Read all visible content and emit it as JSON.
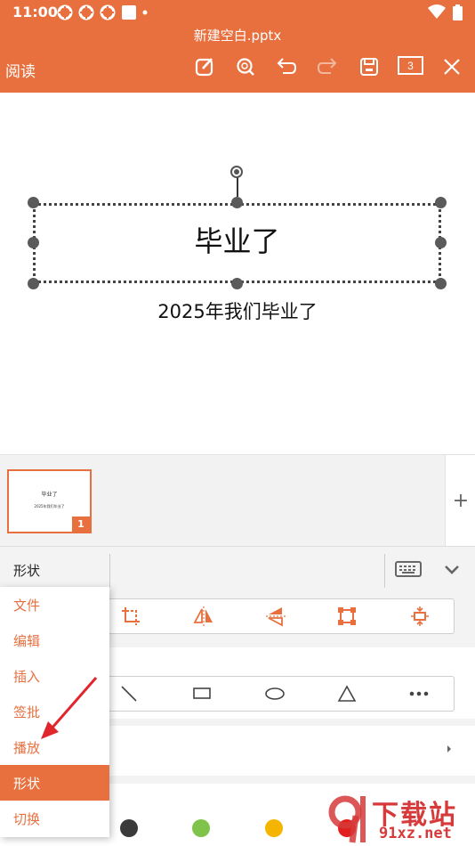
{
  "status_bar": {
    "time": "11:00",
    "icons": [
      "notification-icon",
      "notification-icon",
      "notification-icon",
      "square-icon",
      "dot-icon"
    ],
    "right_icons": [
      "wifi-icon",
      "battery-icon"
    ]
  },
  "header": {
    "file_name": "新建空白.pptx",
    "mode_label": "阅读",
    "page_count": "3",
    "toolbar_icons": [
      "edit-icon",
      "search-icon",
      "undo-icon",
      "redo-icon",
      "save-icon",
      "page-count",
      "close-icon"
    ]
  },
  "slide": {
    "title": "毕业了",
    "subtitle": "2025年我们毕业了"
  },
  "thumbnails": {
    "items": [
      {
        "number": "1",
        "title": "毕业了",
        "subtitle": "2025年我们毕业了"
      }
    ],
    "add_icon": "+"
  },
  "bottom_panel": {
    "current_tab": "形状",
    "arrange_tools": [
      "crop-icon",
      "flip-horizontal-icon",
      "flip-vertical-icon",
      "resize-icon",
      "align-center-icon"
    ],
    "shape_tools": [
      "line-icon",
      "rectangle-icon",
      "ellipse-icon",
      "triangle-icon",
      "more-icon"
    ],
    "color_swatches": [
      "#3a3a3a",
      "#7fc34a",
      "#f5b400",
      "#e02020"
    ]
  },
  "menu": {
    "items": [
      {
        "label": "文件",
        "active": false
      },
      {
        "label": "编辑",
        "active": false
      },
      {
        "label": "插入",
        "active": false
      },
      {
        "label": "签批",
        "active": false
      },
      {
        "label": "播放",
        "active": false
      },
      {
        "label": "形状",
        "active": true
      },
      {
        "label": "切换",
        "active": false
      }
    ]
  },
  "watermark": {
    "cn": "下载站",
    "en": "91xz.net"
  },
  "colors": {
    "accent": "#E8703F",
    "annotation_arrow": "#E0262C"
  }
}
